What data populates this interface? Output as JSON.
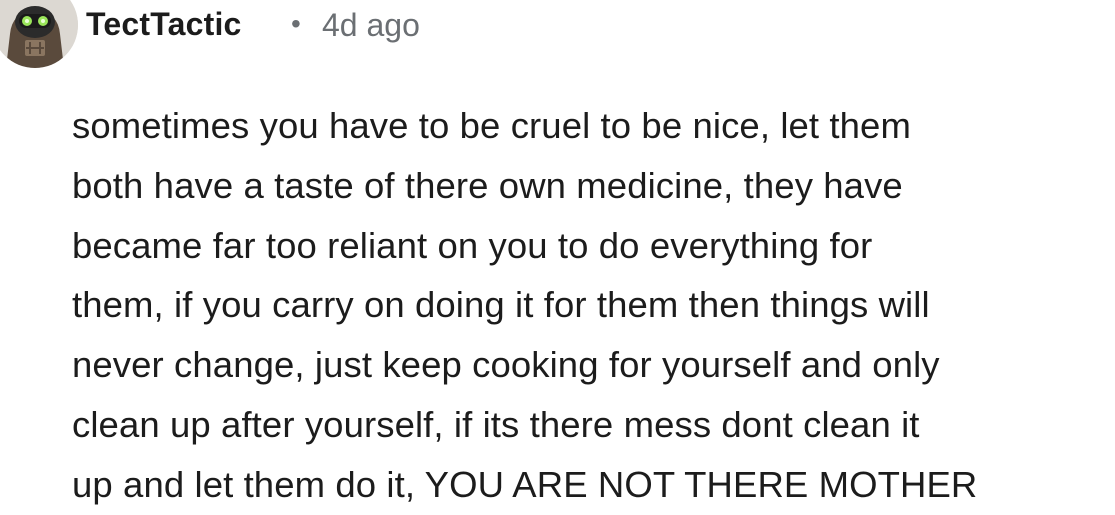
{
  "comment": {
    "username": "TectTactic",
    "separator": "•",
    "timestamp": "4d ago",
    "avatar_icon": "robot-avatar-icon",
    "body_lines": [
      "sometimes you have to be cruel to be nice, let them",
      "both have a taste of there own medicine, they have",
      "became far too reliant on you to do everything for",
      "them, if you carry on doing it for them then things will",
      "never change, just keep cooking for yourself and only",
      "clean up after yourself, if its there mess dont clean it",
      "up and let them do it, YOU ARE NOT THERE MOTHER"
    ]
  }
}
